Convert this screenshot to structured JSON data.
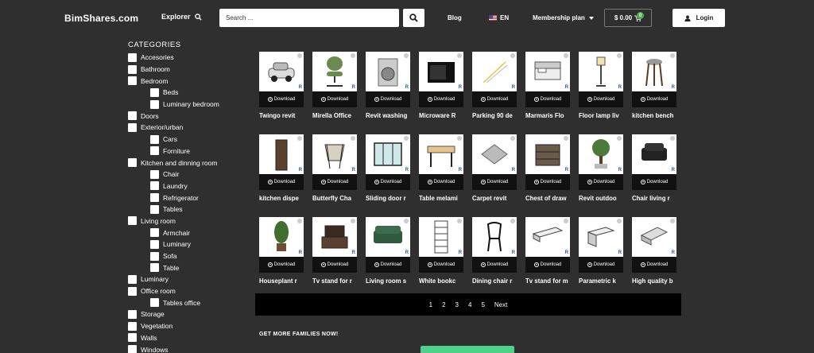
{
  "header": {
    "logo": "BimShares.com",
    "explorer": "Explorer",
    "search_placeholder": "Search ...",
    "blog": "Blog",
    "lang": "EN",
    "membership": "Membership plan",
    "cart_total": "$ 0.00",
    "cart_count": "0",
    "login": "Login"
  },
  "sidebar": {
    "title": "CATEGORIES",
    "items": [
      {
        "label": "Accesories",
        "sub": false
      },
      {
        "label": "Bathroom",
        "sub": false
      },
      {
        "label": "Bedroom",
        "sub": false
      },
      {
        "label": "Beds",
        "sub": true
      },
      {
        "label": "Luminary bedroom",
        "sub": true
      },
      {
        "label": "Doors",
        "sub": false
      },
      {
        "label": "Exterior/urban",
        "sub": false
      },
      {
        "label": "Cars",
        "sub": true
      },
      {
        "label": "Forniture",
        "sub": true
      },
      {
        "label": "Kitchen and dinning room",
        "sub": false
      },
      {
        "label": "Chair",
        "sub": true
      },
      {
        "label": "Laundry",
        "sub": true
      },
      {
        "label": "Refrigerator",
        "sub": true
      },
      {
        "label": "Tables",
        "sub": true
      },
      {
        "label": "Living room",
        "sub": false
      },
      {
        "label": "Armchair",
        "sub": true
      },
      {
        "label": "Luminary",
        "sub": true
      },
      {
        "label": "Sofa",
        "sub": true
      },
      {
        "label": "Table",
        "sub": true
      },
      {
        "label": "Luminary",
        "sub": false
      },
      {
        "label": "Office room",
        "sub": false
      },
      {
        "label": "Tables office",
        "sub": true
      },
      {
        "label": "Storage",
        "sub": false
      },
      {
        "label": "Vegetation",
        "sub": false
      },
      {
        "label": "Walls",
        "sub": false
      },
      {
        "label": "Windows",
        "sub": false
      }
    ]
  },
  "grid": {
    "download_label": "Download",
    "rows": [
      [
        {
          "name": "Twingo revit",
          "icon": "car"
        },
        {
          "name": "Mirella Office",
          "icon": "office-chair"
        },
        {
          "name": "Revit washing",
          "icon": "washer"
        },
        {
          "name": "Microware R",
          "icon": "microwave"
        },
        {
          "name": "Parking 90 de",
          "icon": "parking"
        },
        {
          "name": "Marmaris Flo",
          "icon": "bed"
        },
        {
          "name": "Floor lamp liv",
          "icon": "floor-lamp"
        },
        {
          "name": "kitchen bench",
          "icon": "stool"
        }
      ],
      [
        {
          "name": "kitchen dispe",
          "icon": "cabinet"
        },
        {
          "name": "Butterfly Cha",
          "icon": "butterfly-chair"
        },
        {
          "name": "Sliding door r",
          "icon": "sliding-door"
        },
        {
          "name": "Table melami",
          "icon": "table"
        },
        {
          "name": "Carpet revit",
          "icon": "carpet"
        },
        {
          "name": "Chest of draw",
          "icon": "chest"
        },
        {
          "name": "Revit outdoo",
          "icon": "tree"
        },
        {
          "name": "Chair living r",
          "icon": "armchair"
        }
      ],
      [
        {
          "name": "Houseplant r",
          "icon": "houseplant"
        },
        {
          "name": "Tv stand for r",
          "icon": "tv-stand"
        },
        {
          "name": "Living room s",
          "icon": "sofa"
        },
        {
          "name": "White bookc",
          "icon": "bookcase"
        },
        {
          "name": "Dining chair r",
          "icon": "dining-chair"
        },
        {
          "name": "Tv stand for m",
          "icon": "tv-stand-white"
        },
        {
          "name": "Parametric k",
          "icon": "kitchen-unit"
        },
        {
          "name": "High quality b",
          "icon": "bed-white"
        }
      ]
    ]
  },
  "pagination": {
    "pages": [
      "1",
      "2",
      "3",
      "4",
      "5"
    ],
    "next": "Next"
  },
  "footer": {
    "more": "GET MORE FAMILIES NOW!"
  }
}
